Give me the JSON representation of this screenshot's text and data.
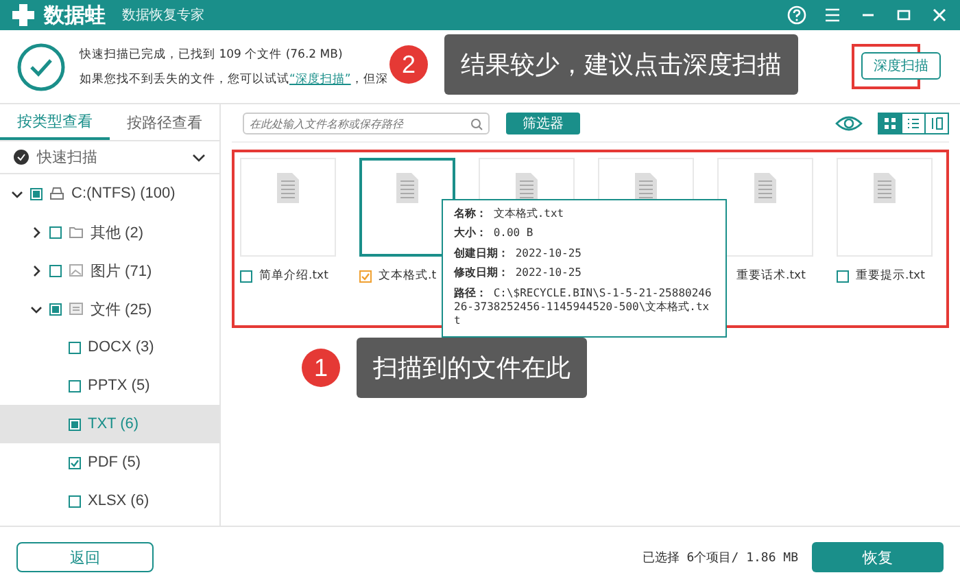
{
  "app": {
    "name": "数据蛙",
    "subtitle": "数据恢复专家"
  },
  "scan": {
    "summary": "快速扫描已完成，已找到 109 个文件 (76.2 MB)",
    "hint_prefix": "如果您找不到丢失的文件，您可以试试",
    "hint_link": "“深度扫描”",
    "hint_suffix": "，但深",
    "deep_scan_button": "深度扫描"
  },
  "callouts": [
    {
      "number": "2",
      "text": "结果较少，建议点击深度扫描"
    },
    {
      "number": "1",
      "text": "扫描到的文件在此"
    }
  ],
  "view_tabs": [
    {
      "label": "按类型查看",
      "selected": true
    },
    {
      "label": "按路径查看",
      "selected": false
    }
  ],
  "scan_mode": "快速扫描",
  "tree": [
    {
      "label": "C:(NTFS) (100)",
      "partial": true,
      "expanded": true,
      "kind": "drive",
      "selected": false,
      "children": [
        {
          "label": "其他 (2)",
          "checked": false,
          "expanded": false,
          "kind": "folder",
          "selected": false
        },
        {
          "label": "图片 (71)",
          "checked": false,
          "expanded": false,
          "kind": "image",
          "selected": false
        },
        {
          "label": "文件 (25)",
          "partial": true,
          "expanded": true,
          "kind": "document",
          "selected": false,
          "children": [
            {
              "label": "DOCX (3)",
              "checked": false,
              "selected": false
            },
            {
              "label": "PPTX (5)",
              "checked": false,
              "selected": false
            },
            {
              "label": "TXT (6)",
              "partial": true,
              "selected": true
            },
            {
              "label": "PDF (5)",
              "checked": true,
              "selected": false
            },
            {
              "label": "XLSX (6)",
              "checked": false,
              "selected": false
            }
          ]
        }
      ]
    }
  ],
  "search": {
    "placeholder": "在此处输入文件名称或保存路径"
  },
  "filter_button": "筛选器",
  "view_modes": [
    {
      "kind": "grid",
      "selected": true
    },
    {
      "kind": "list",
      "selected": false
    },
    {
      "kind": "detail",
      "selected": false
    }
  ],
  "files": [
    {
      "name": "简单介绍.txt",
      "checked": false,
      "selected": false
    },
    {
      "name": "文本格式.t",
      "checked": true,
      "selected": true
    },
    {
      "selected": false
    },
    {
      "selected": false
    },
    {
      "name": "重要话术.txt",
      "selected": false
    },
    {
      "name": "重要提示.txt",
      "checked": false,
      "selected": false
    }
  ],
  "tooltip": [
    {
      "label": "名称：",
      "value": "文本格式.txt"
    },
    {
      "label": "大小：",
      "value": "0.00 B"
    },
    {
      "label": "创建日期：",
      "value": "2022-10-25"
    },
    {
      "label": "修改日期：",
      "value": "2022-10-25"
    },
    {
      "label": "路径：",
      "value": "C:\\$RECYCLE.BIN\\S-1-5-21-2588024626-3738252456-1145944520-500\\文本格式.txt"
    }
  ],
  "footer": {
    "back_button": "返回",
    "status": "已选择 6个项目/ 1.86 MB",
    "recover_button": "恢复"
  }
}
